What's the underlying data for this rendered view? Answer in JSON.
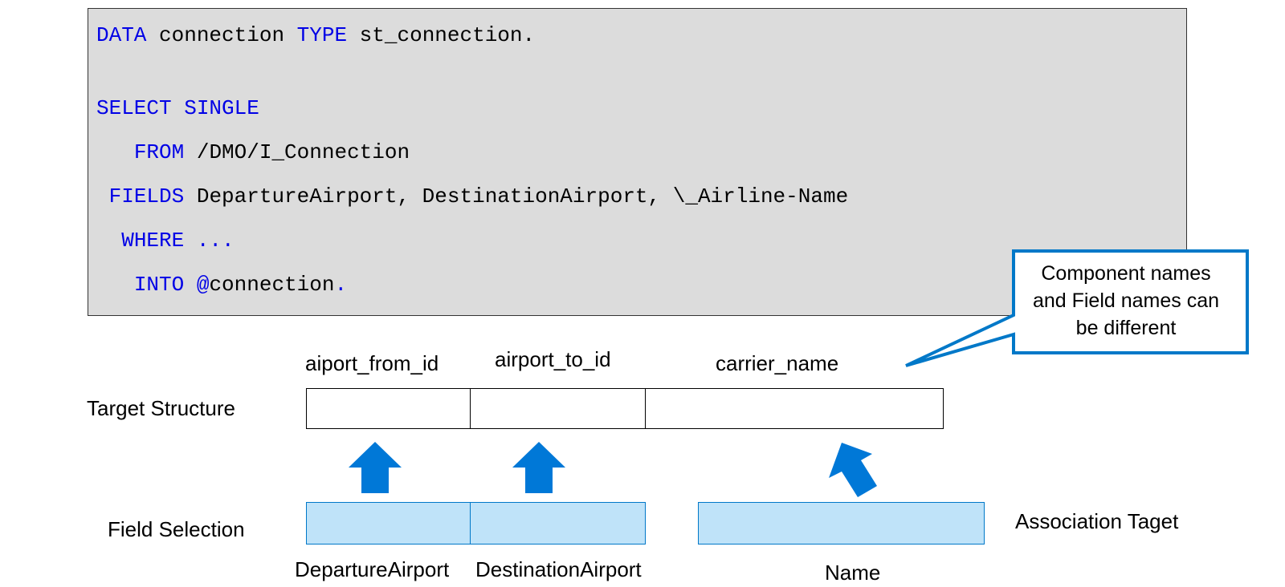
{
  "code": {
    "lines": [
      {
        "indent": "",
        "kw1": "DATA",
        "t1": " connection ",
        "kw2": "TYPE",
        "t2": " st_connection."
      },
      {
        "indent": "",
        "kw1": "SELECT SINGLE",
        "t1": "",
        "kw2": "",
        "t2": ""
      },
      {
        "indent": "   ",
        "kw1": "FROM",
        "t1": " /DMO/I_Connection",
        "kw2": "",
        "t2": ""
      },
      {
        "indent": " ",
        "kw1": "FIELDS",
        "t1": " DepartureAirport, DestinationAirport, \\_Airline-Name",
        "kw2": "",
        "t2": ""
      },
      {
        "indent": "  ",
        "kw1": "WHERE ...",
        "t1": "",
        "kw2": "",
        "t2": ""
      },
      {
        "indent": "   ",
        "kw1": "INTO",
        "t1": " ",
        "kw2": "@",
        "t2": "connection",
        "kw3": "."
      }
    ]
  },
  "diagram": {
    "target_structure_label": "Target Structure",
    "field_selection_label": "Field Selection",
    "association_target_label": "Association Taget",
    "target_components": [
      "aiport_from_id",
      "airport_to_id",
      "carrier_name"
    ],
    "selected_fields": [
      "DepartureAirport",
      "DestinationAirport",
      "Name"
    ],
    "callout_line1": "Component names",
    "callout_line2": "and Field names can",
    "callout_line3": "be different"
  },
  "colors": {
    "keyword": "#0000e6",
    "code_background": "#dcdcdc",
    "selection_fill": "#bfe3f9",
    "accent_blue": "#0078c8"
  }
}
